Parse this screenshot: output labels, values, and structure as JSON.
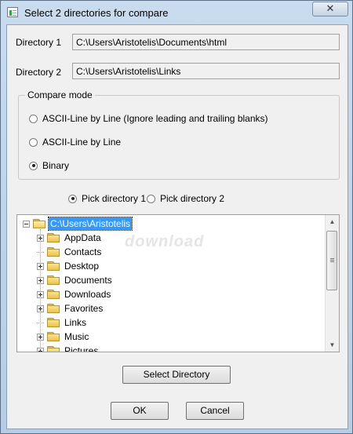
{
  "window": {
    "title": "Select 2 directories for compare",
    "close_label": "✕"
  },
  "directory1": {
    "label": "Directory 1",
    "value": "C:\\Users\\Aristotelis\\Documents\\html"
  },
  "directory2": {
    "label": "Directory 2",
    "value": "C:\\Users\\Aristotelis\\Links"
  },
  "compare_mode": {
    "title": "Compare mode",
    "options": [
      {
        "label": "ASCII-Line by Line (Ignore leading and trailing blanks)",
        "checked": false
      },
      {
        "label": "ASCII-Line by Line",
        "checked": false
      },
      {
        "label": "Binary",
        "checked": true
      }
    ]
  },
  "pick": {
    "options": [
      {
        "label": "Pick directory 1",
        "checked": true
      },
      {
        "label": "Pick directory 2",
        "checked": false
      }
    ]
  },
  "tree": {
    "root": "C:\\Users\\Aristotelis",
    "items": [
      {
        "label": "AppData",
        "expandable": true
      },
      {
        "label": "Contacts",
        "expandable": false
      },
      {
        "label": "Desktop",
        "expandable": true
      },
      {
        "label": "Documents",
        "expandable": true
      },
      {
        "label": "Downloads",
        "expandable": true
      },
      {
        "label": "Favorites",
        "expandable": true
      },
      {
        "label": "Links",
        "expandable": false
      },
      {
        "label": "Music",
        "expandable": true
      },
      {
        "label": "Pictures",
        "expandable": true
      }
    ]
  },
  "watermark": "download",
  "buttons": {
    "select_directory": "Select Directory",
    "ok": "OK",
    "cancel": "Cancel"
  }
}
